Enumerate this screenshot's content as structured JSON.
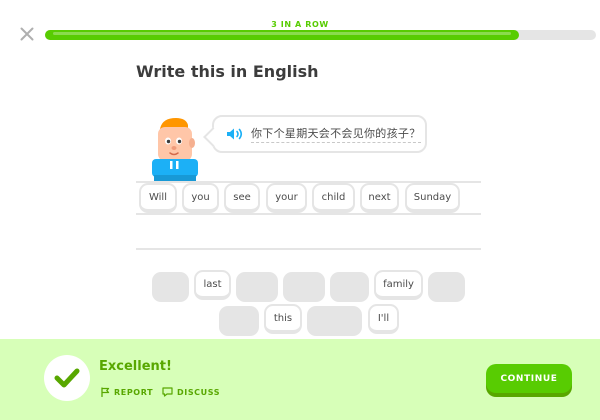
{
  "header": {
    "streak_label": "3 IN A ROW",
    "progress": 0.86,
    "close_icon": "close-icon"
  },
  "lesson": {
    "title": "Write this in English",
    "prompt": "你下个星期天会不会见你的孩子？",
    "speaker_icon": "speaker-icon"
  },
  "answer": {
    "words": [
      "Will",
      "you",
      "see",
      "your",
      "child",
      "next",
      "Sunday"
    ]
  },
  "bank": {
    "row1": [
      "",
      "last",
      "",
      "",
      "",
      "family",
      ""
    ],
    "row2": [
      "",
      "this",
      "",
      "I'll"
    ]
  },
  "footer": {
    "message": "Excellent!",
    "report_label": "REPORT",
    "discuss_label": "DISCUSS",
    "continue_label": "CONTINUE"
  },
  "colors": {
    "accent": "#58cc02",
    "accent_dark": "#58a700",
    "footer_bg": "#d7ffb8",
    "chip_border": "#e5e5e5",
    "speaker": "#1cb0f6"
  }
}
